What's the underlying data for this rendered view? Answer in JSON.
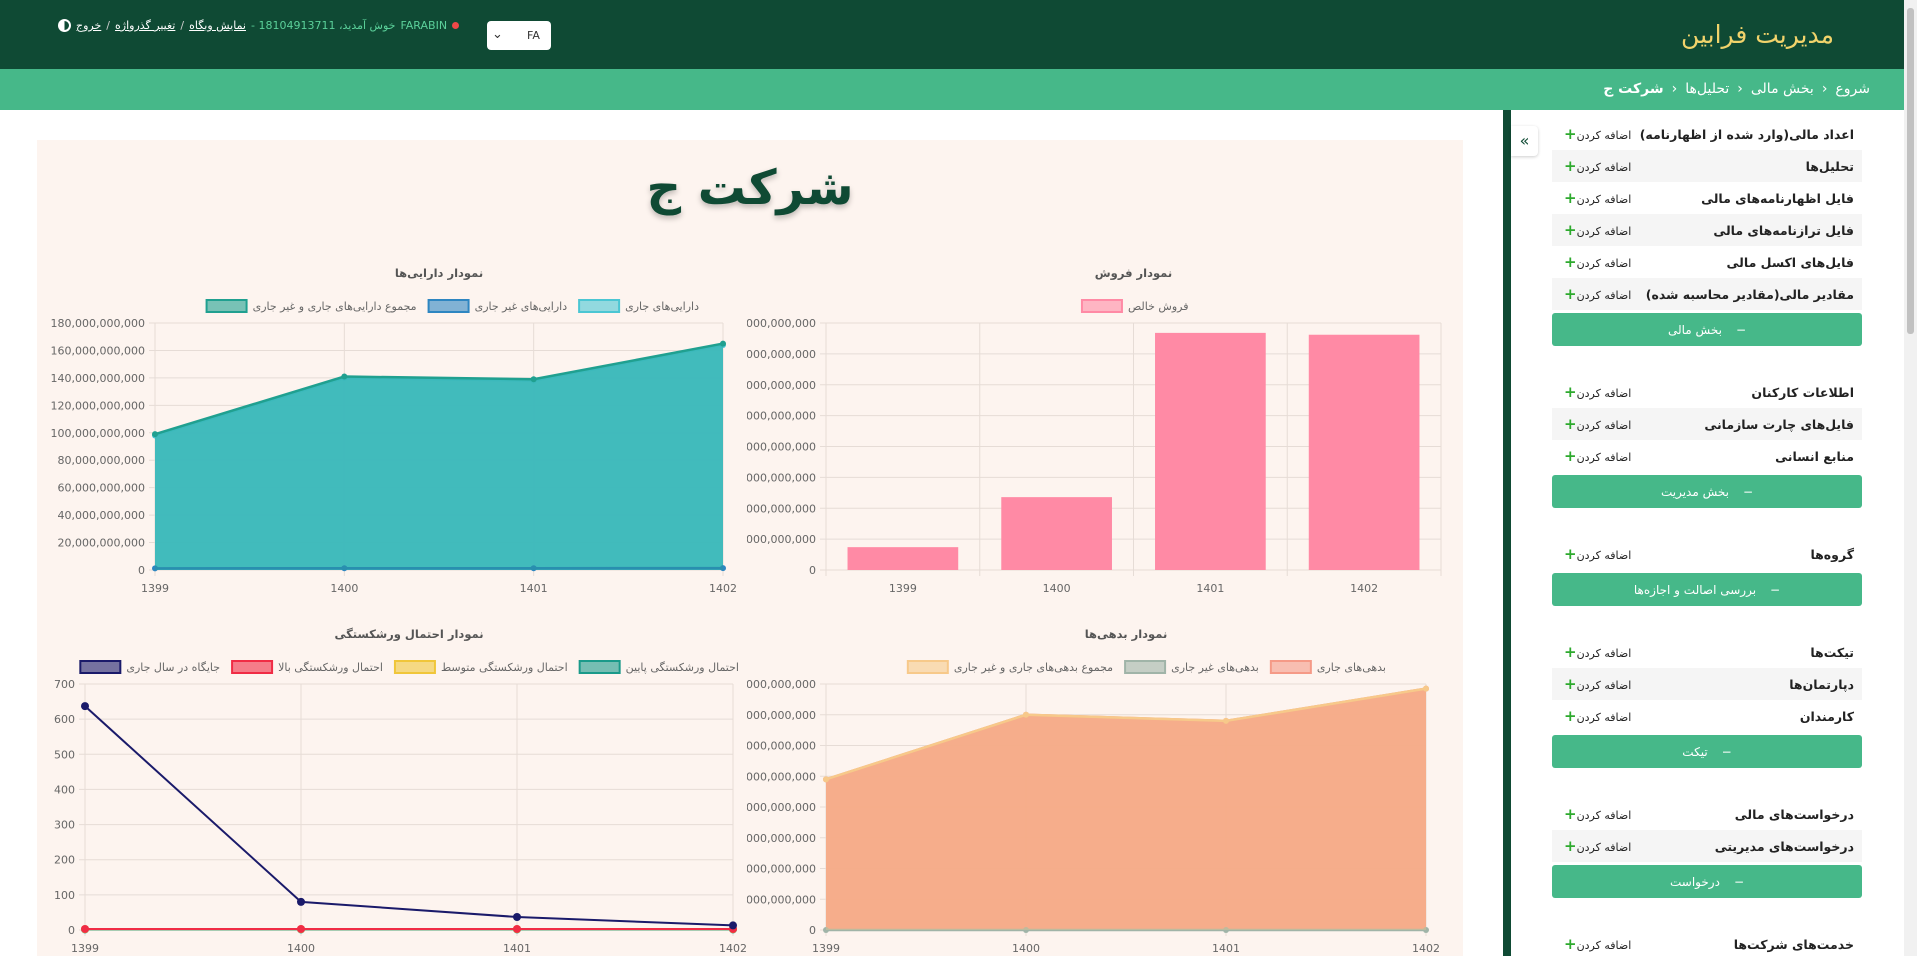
{
  "header": {
    "brand": "مدیریت فرابین",
    "language": "FA",
    "status_user": "FARABIN",
    "welcome": "- خوش آمدید، 18104913711",
    "show_website": "نمایش وبگاه",
    "change_password": "تغییر گذرواژه",
    "logout": "خروج",
    "separator": "/",
    "status_color": "#ef4848"
  },
  "breadcrumbs": [
    "شروع",
    "بخش مالی",
    "تحلیل‌ها",
    "شرکت ج"
  ],
  "page": {
    "title": "شرکت ج"
  },
  "sidebar": {
    "add_label": "اضافه کردن",
    "sections": [
      {
        "items": [
          "اعداد مالی(وارد شده از اظهارنامه)",
          "تحلیل‌ها",
          "فایل اظهارنامه‌های مالی",
          "فایل ترازنامه‌های مالی",
          "فایل‌های اکسل مالی",
          "مقادیر مالی(مقادیر محاسبه شده)"
        ],
        "button": "بخش مالی"
      },
      {
        "items": [
          "اطلاعات کارکنان",
          "فایل‌های چارت سازمانی",
          "منابع انسانی"
        ],
        "button": "بخش مدیریت"
      },
      {
        "items": [
          "گروه‌ها"
        ],
        "button": "بررسی اصالت و اجازه‌ها"
      },
      {
        "items": [
          "تیکت‌ها",
          "دپارتمان‌ها",
          "کارمندان"
        ],
        "button": "تیکت"
      },
      {
        "items": [
          "درخواست‌های مالی",
          "درخواست‌های مدیریتی"
        ],
        "button": "درخواست"
      },
      {
        "items": [
          "خدمت‌های شرکت‌ها"
        ],
        "button": ""
      }
    ]
  },
  "chart_data": [
    {
      "id": "sales",
      "type": "bar",
      "title": "نمودار فروش",
      "categories": [
        "1399",
        "1400",
        "1401",
        "1402"
      ],
      "series": [
        {
          "name": "فروش خالص",
          "values": [
            37000000000,
            118000000000,
            384000000000,
            381000000000
          ],
          "color": "#ff8aa5"
        }
      ],
      "ylim": [
        0,
        400000000000
      ],
      "ytick_step": 50000000000,
      "grid": true,
      "legend": "top"
    },
    {
      "id": "assets",
      "type": "area",
      "title": "نمودار دارایی‌ها",
      "categories": [
        "1399",
        "1400",
        "1401",
        "1402"
      ],
      "series": [
        {
          "name": "دارایی‌های جاری",
          "values": [
            98000000000,
            140000000000,
            138000000000,
            164000000000
          ],
          "color": "#4bc6d3"
        },
        {
          "name": "دارایی‌های غیر جاری",
          "values": [
            1200000000,
            1300000000,
            1300000000,
            1400000000
          ],
          "color": "#2e86c1"
        },
        {
          "name": "مجموع دارایی‌های جاری و غیر جاری",
          "values": [
            99000000000,
            141000000000,
            139000000000,
            165000000000
          ],
          "color": "#20a090"
        }
      ],
      "ylim": [
        0,
        180000000000
      ],
      "ytick_step": 20000000000,
      "grid": true,
      "legend": "top"
    },
    {
      "id": "debts",
      "type": "area",
      "title": "نمودار بدهی‌ها",
      "categories": [
        "1399",
        "1400",
        "1401",
        "1402"
      ],
      "series": [
        {
          "name": "بدهی‌های جاری",
          "values": [
            98000000000,
            140000000000,
            136000000000,
            157000000000
          ],
          "color": "#f59a87"
        },
        {
          "name": "بدهی‌های غیر جاری",
          "values": [
            0,
            0,
            0,
            0
          ],
          "color": "#a0b4a8"
        },
        {
          "name": "مجموع بدهی‌های جاری و غیر جاری",
          "values": [
            98000000000,
            140000000000,
            136000000000,
            157000000000
          ],
          "color": "#f7c98a"
        }
      ],
      "ylim": [
        0,
        160000000000
      ],
      "ytick_step": 20000000000,
      "grid": true,
      "legend": "top"
    },
    {
      "id": "bankruptcy",
      "type": "line",
      "title": "نمودار احتمال ورشکستگی",
      "categories": [
        "1399",
        "1400",
        "1401",
        "1402"
      ],
      "series": [
        {
          "name": "احتمال ورشکستگی پایین",
          "values": [
            1.5,
            1.5,
            1.5,
            1.5
          ],
          "color": "#1a9a8a"
        },
        {
          "name": "احتمال ورشکستگی متوسط",
          "values": [
            2.5,
            2.5,
            2.5,
            2.5
          ],
          "color": "#f0c63a"
        },
        {
          "name": "احتمال ورشکستگی بالا",
          "values": [
            3,
            3,
            3,
            3
          ],
          "color": "#f02c45"
        },
        {
          "name": "جایگاه در سال جاری",
          "values": [
            637,
            80,
            37,
            13
          ],
          "color": "#1a1a6a"
        }
      ],
      "ylim": [
        0,
        700
      ],
      "ytick_step": 100,
      "grid": true,
      "legend": "top"
    }
  ]
}
